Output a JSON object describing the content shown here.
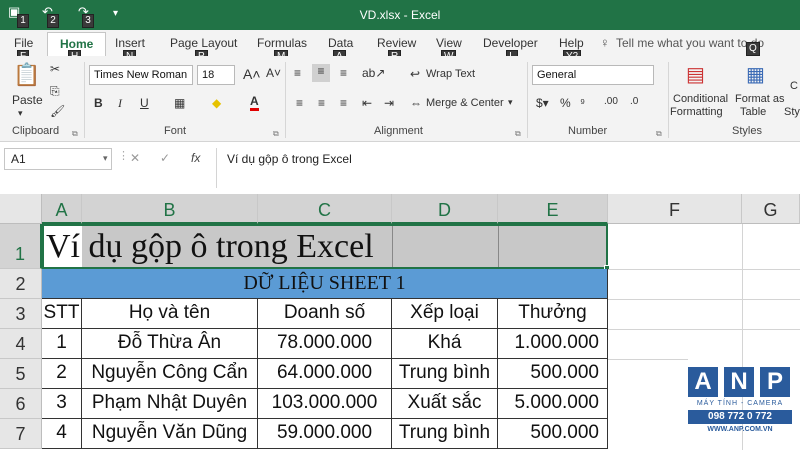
{
  "window": {
    "title": "VD.xlsx  -  Excel"
  },
  "quick_access": {
    "keytips": [
      "1",
      "2",
      "3"
    ]
  },
  "tabs": [
    {
      "label": "File",
      "keytip": "F"
    },
    {
      "label": "Home",
      "keytip": "H"
    },
    {
      "label": "Insert",
      "keytip": "N"
    },
    {
      "label": "Page Layout",
      "keytip": "P"
    },
    {
      "label": "Formulas",
      "keytip": "M"
    },
    {
      "label": "Data",
      "keytip": "A"
    },
    {
      "label": "Review",
      "keytip": "R"
    },
    {
      "label": "View",
      "keytip": "W"
    },
    {
      "label": "Developer",
      "keytip": "L"
    },
    {
      "label": "Help",
      "keytip": "Y2"
    }
  ],
  "tell_me": {
    "label": "Tell me what you want to do",
    "keytip": "Q"
  },
  "ribbon": {
    "clipboard": {
      "label": "Clipboard",
      "paste": "Paste"
    },
    "font": {
      "label": "Font",
      "name": "Times New Roman",
      "size": "18",
      "bold": "B",
      "italic": "I",
      "underline": "U",
      "font_color": "A"
    },
    "alignment": {
      "label": "Alignment",
      "wrap_text": "Wrap Text",
      "merge_center": "Merge & Center"
    },
    "number": {
      "label": "Number",
      "format": "General"
    },
    "styles": {
      "label": "Styles",
      "conditional": "Conditional",
      "formatting": "Formatting",
      "format_as": "Format as",
      "table": "Table",
      "cell_styles_partial": "Styl",
      "cut_partial": "C"
    }
  },
  "formula_bar": {
    "name_box": "A1",
    "cancel": "✕",
    "enter": "✓",
    "fx": "fx",
    "formula": "Ví dụ gộp ô trong Excel"
  },
  "sheet": {
    "columns": [
      "A",
      "B",
      "C",
      "D",
      "E",
      "F",
      "G"
    ],
    "rows": [
      "1",
      "2",
      "3",
      "4",
      "5",
      "6",
      "7"
    ],
    "title": "Ví dụ gộp ô trong Excel",
    "banner": "DỮ LIỆU SHEET 1",
    "headers": [
      "STT",
      "Họ và tên",
      "Doanh số",
      "Xếp loại",
      "Thưởng"
    ],
    "data": [
      [
        "1",
        "Đỗ Thừa Ân",
        "78.000.000",
        "Khá",
        "1.000.000"
      ],
      [
        "2",
        "Nguyễn Công Cẩn",
        "64.000.000",
        "Trung bình",
        "500.000"
      ],
      [
        "3",
        "Phạm Nhật Duyên",
        "103.000.000",
        "Xuất sắc",
        "5.000.000"
      ],
      [
        "4",
        "Nguyễn Văn Dũng",
        "59.000.000",
        "Trung bình",
        "500.000"
      ]
    ]
  },
  "watermark": {
    "letters": [
      "A",
      "N",
      "P"
    ],
    "line1": "MÁY TÍNH - CAMERA",
    "phone": "098 772 0 772",
    "site": "WWW.ANP.COM.VN"
  },
  "colors": {
    "excel_green": "#217346",
    "banner_blue": "#5b9bd5",
    "selection_gray": "#c8c8c8",
    "logo_blue": "#2a5b9c"
  }
}
